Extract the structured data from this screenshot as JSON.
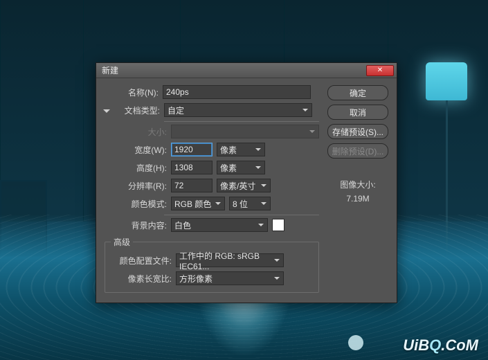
{
  "dialog": {
    "title": "新建",
    "name_label": "名称(N):",
    "name_value": "240ps",
    "doc_type_label": "文档类型:",
    "doc_type_value": "自定",
    "size_label": "大小:",
    "width_label": "宽度(W):",
    "width_value": "1920",
    "width_unit": "像素",
    "height_label": "高度(H):",
    "height_value": "1308",
    "height_unit": "像素",
    "res_label": "分辨率(R):",
    "res_value": "72",
    "res_unit": "像素/英寸",
    "mode_label": "颜色模式:",
    "mode_value": "RGB 颜色",
    "bit_depth": "8 位",
    "bg_label": "背景内容:",
    "bg_value": "白色",
    "advanced_legend": "高级",
    "profile_label": "颜色配置文件:",
    "profile_value": "工作中的 RGB: sRGB IEC61...",
    "aspect_label": "像素长宽比:",
    "aspect_value": "方形像素"
  },
  "buttons": {
    "ok": "确定",
    "cancel": "取消",
    "save_preset": "存储预设(S)...",
    "delete_preset": "删除预设(D)..."
  },
  "info": {
    "image_size_label": "图像大小:",
    "image_size_value": "7.19M"
  },
  "watermark": "UiBQ.CoM"
}
